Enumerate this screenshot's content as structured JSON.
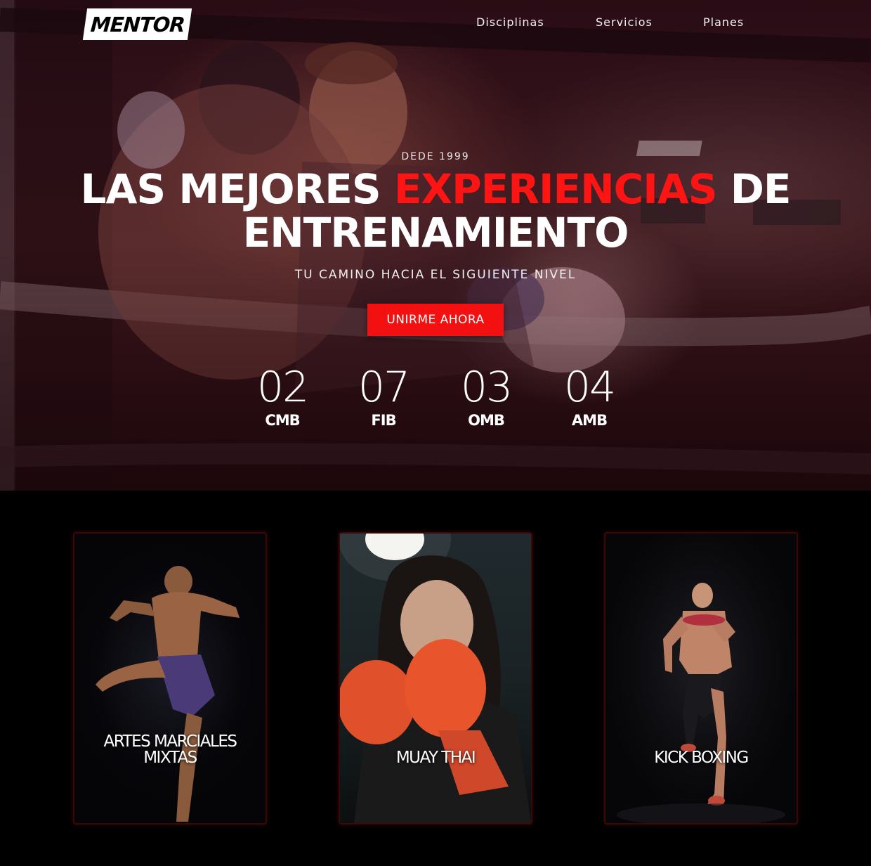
{
  "nav": {
    "logo": "MENTOR",
    "links": [
      "Disciplinas",
      "Servicios",
      "Planes"
    ]
  },
  "hero": {
    "eyebrow": "DEDE 1999",
    "headline_part1": "LAS MEJORES ",
    "headline_accent": "EXPERIENCIAS",
    "headline_part2": " DE",
    "headline_line2": "ENTRENAMIENTO",
    "tagline": "TU CAMINO HACIA EL SIGUIENTE NIVEL",
    "cta_label": "UNIRME AHORA",
    "stats": [
      {
        "value": "02",
        "label": "CMB"
      },
      {
        "value": "07",
        "label": "FIB"
      },
      {
        "value": "03",
        "label": "OMB"
      },
      {
        "value": "04",
        "label": "AMB"
      }
    ]
  },
  "disciplines": [
    {
      "line1": "ARTES MARCIALES",
      "line2": "MIXTAS"
    },
    {
      "line1": "MUAY THAI"
    },
    {
      "line1": "KICK BOXING"
    }
  ],
  "colors": {
    "accent": "#ff1414",
    "cta_background": "#f21010",
    "page_background": "#000000",
    "card_border": "#3a0808"
  },
  "icons": {
    "logo": "mentor-wordmark"
  }
}
